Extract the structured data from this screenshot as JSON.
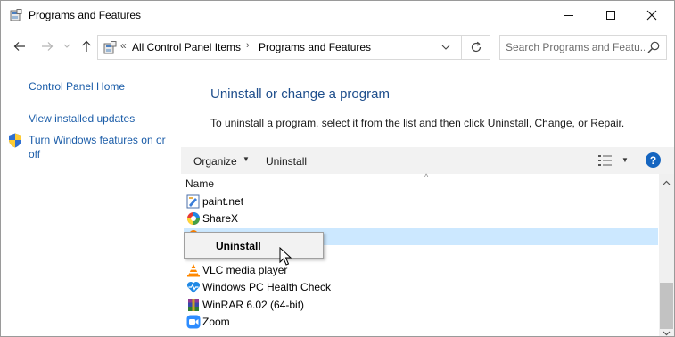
{
  "window": {
    "title": "Programs and Features",
    "controls": {
      "minimize": "—",
      "maximize": "☐",
      "close": "✕"
    }
  },
  "address": {
    "overflow": "«",
    "crumbs": [
      "All Control Panel Items",
      "Programs and Features"
    ],
    "separator": "›"
  },
  "search": {
    "placeholder": "Search Programs and Featu..."
  },
  "sidebar": {
    "links": [
      "Control Panel Home",
      "View installed updates",
      "Turn Windows features on or off"
    ]
  },
  "main": {
    "title": "Uninstall or change a program",
    "description": "To uninstall a program, select it from the list and then click Uninstall, Change, or Repair."
  },
  "toolbar": {
    "organize": "Organize",
    "uninstall": "Uninstall",
    "help": "?"
  },
  "list": {
    "column_header": "Name",
    "items": [
      {
        "label": "paint.net",
        "icon": "paint-net-icon"
      },
      {
        "label": "ShareX",
        "icon": "sharex-icon"
      },
      {
        "label": "",
        "icon": "app-icon",
        "selected": true
      },
      {
        "label": "",
        "icon": ""
      },
      {
        "label": "VLC media player",
        "icon": "vlc-icon"
      },
      {
        "label": "Windows PC Health Check",
        "icon": "health-check-icon"
      },
      {
        "label": "WinRAR 6.02 (64-bit)",
        "icon": "winrar-icon"
      },
      {
        "label": "Zoom",
        "icon": "zoom-icon"
      }
    ]
  },
  "context_menu": {
    "items": [
      "Uninstall"
    ]
  },
  "colors": {
    "link": "#1a5ca8",
    "title": "#1e4e8c",
    "selection": "#cce8ff",
    "help": "#1565c0"
  }
}
